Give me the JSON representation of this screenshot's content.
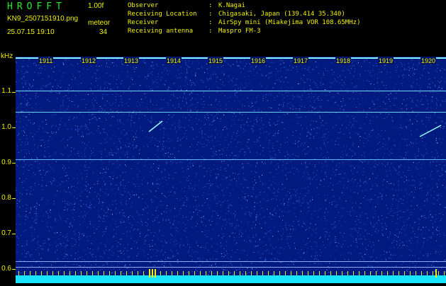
{
  "header": {
    "app_title": "HROFFT",
    "version": "1.00f",
    "filename": "KN9_2507151910.png",
    "mode": "meteor",
    "timestamp": "25.07.15 19:10",
    "count": "34"
  },
  "info": [
    {
      "key": "Observer",
      "sep": ":",
      "value": "K.Nagai"
    },
    {
      "key": "Receiving Location",
      "sep": ":",
      "value": "Chigasaki, Japan (139.414 35.340)"
    },
    {
      "key": "Receiver",
      "sep": ":",
      "value": "AirSpy mini (Miakejima VOR 108.65MHz)"
    },
    {
      "key": "Receiving antenna",
      "sep": ":",
      "value": "Maspro FM-3"
    }
  ],
  "spectrogram": {
    "y_unit": "kHz",
    "y_ticks": [
      "1.1",
      "1.0",
      "0.9",
      "0.8",
      "0.7",
      "0.6"
    ],
    "minute_labels": [
      "1911",
      "1912",
      "1913",
      "1914",
      "1915",
      "1916",
      "1917",
      "1918",
      "1919",
      "1920"
    ],
    "colors": {
      "background": "#001a80",
      "noise": "#3a7cff",
      "signal": "#7ff6ff",
      "label": "#f0f000"
    }
  }
}
